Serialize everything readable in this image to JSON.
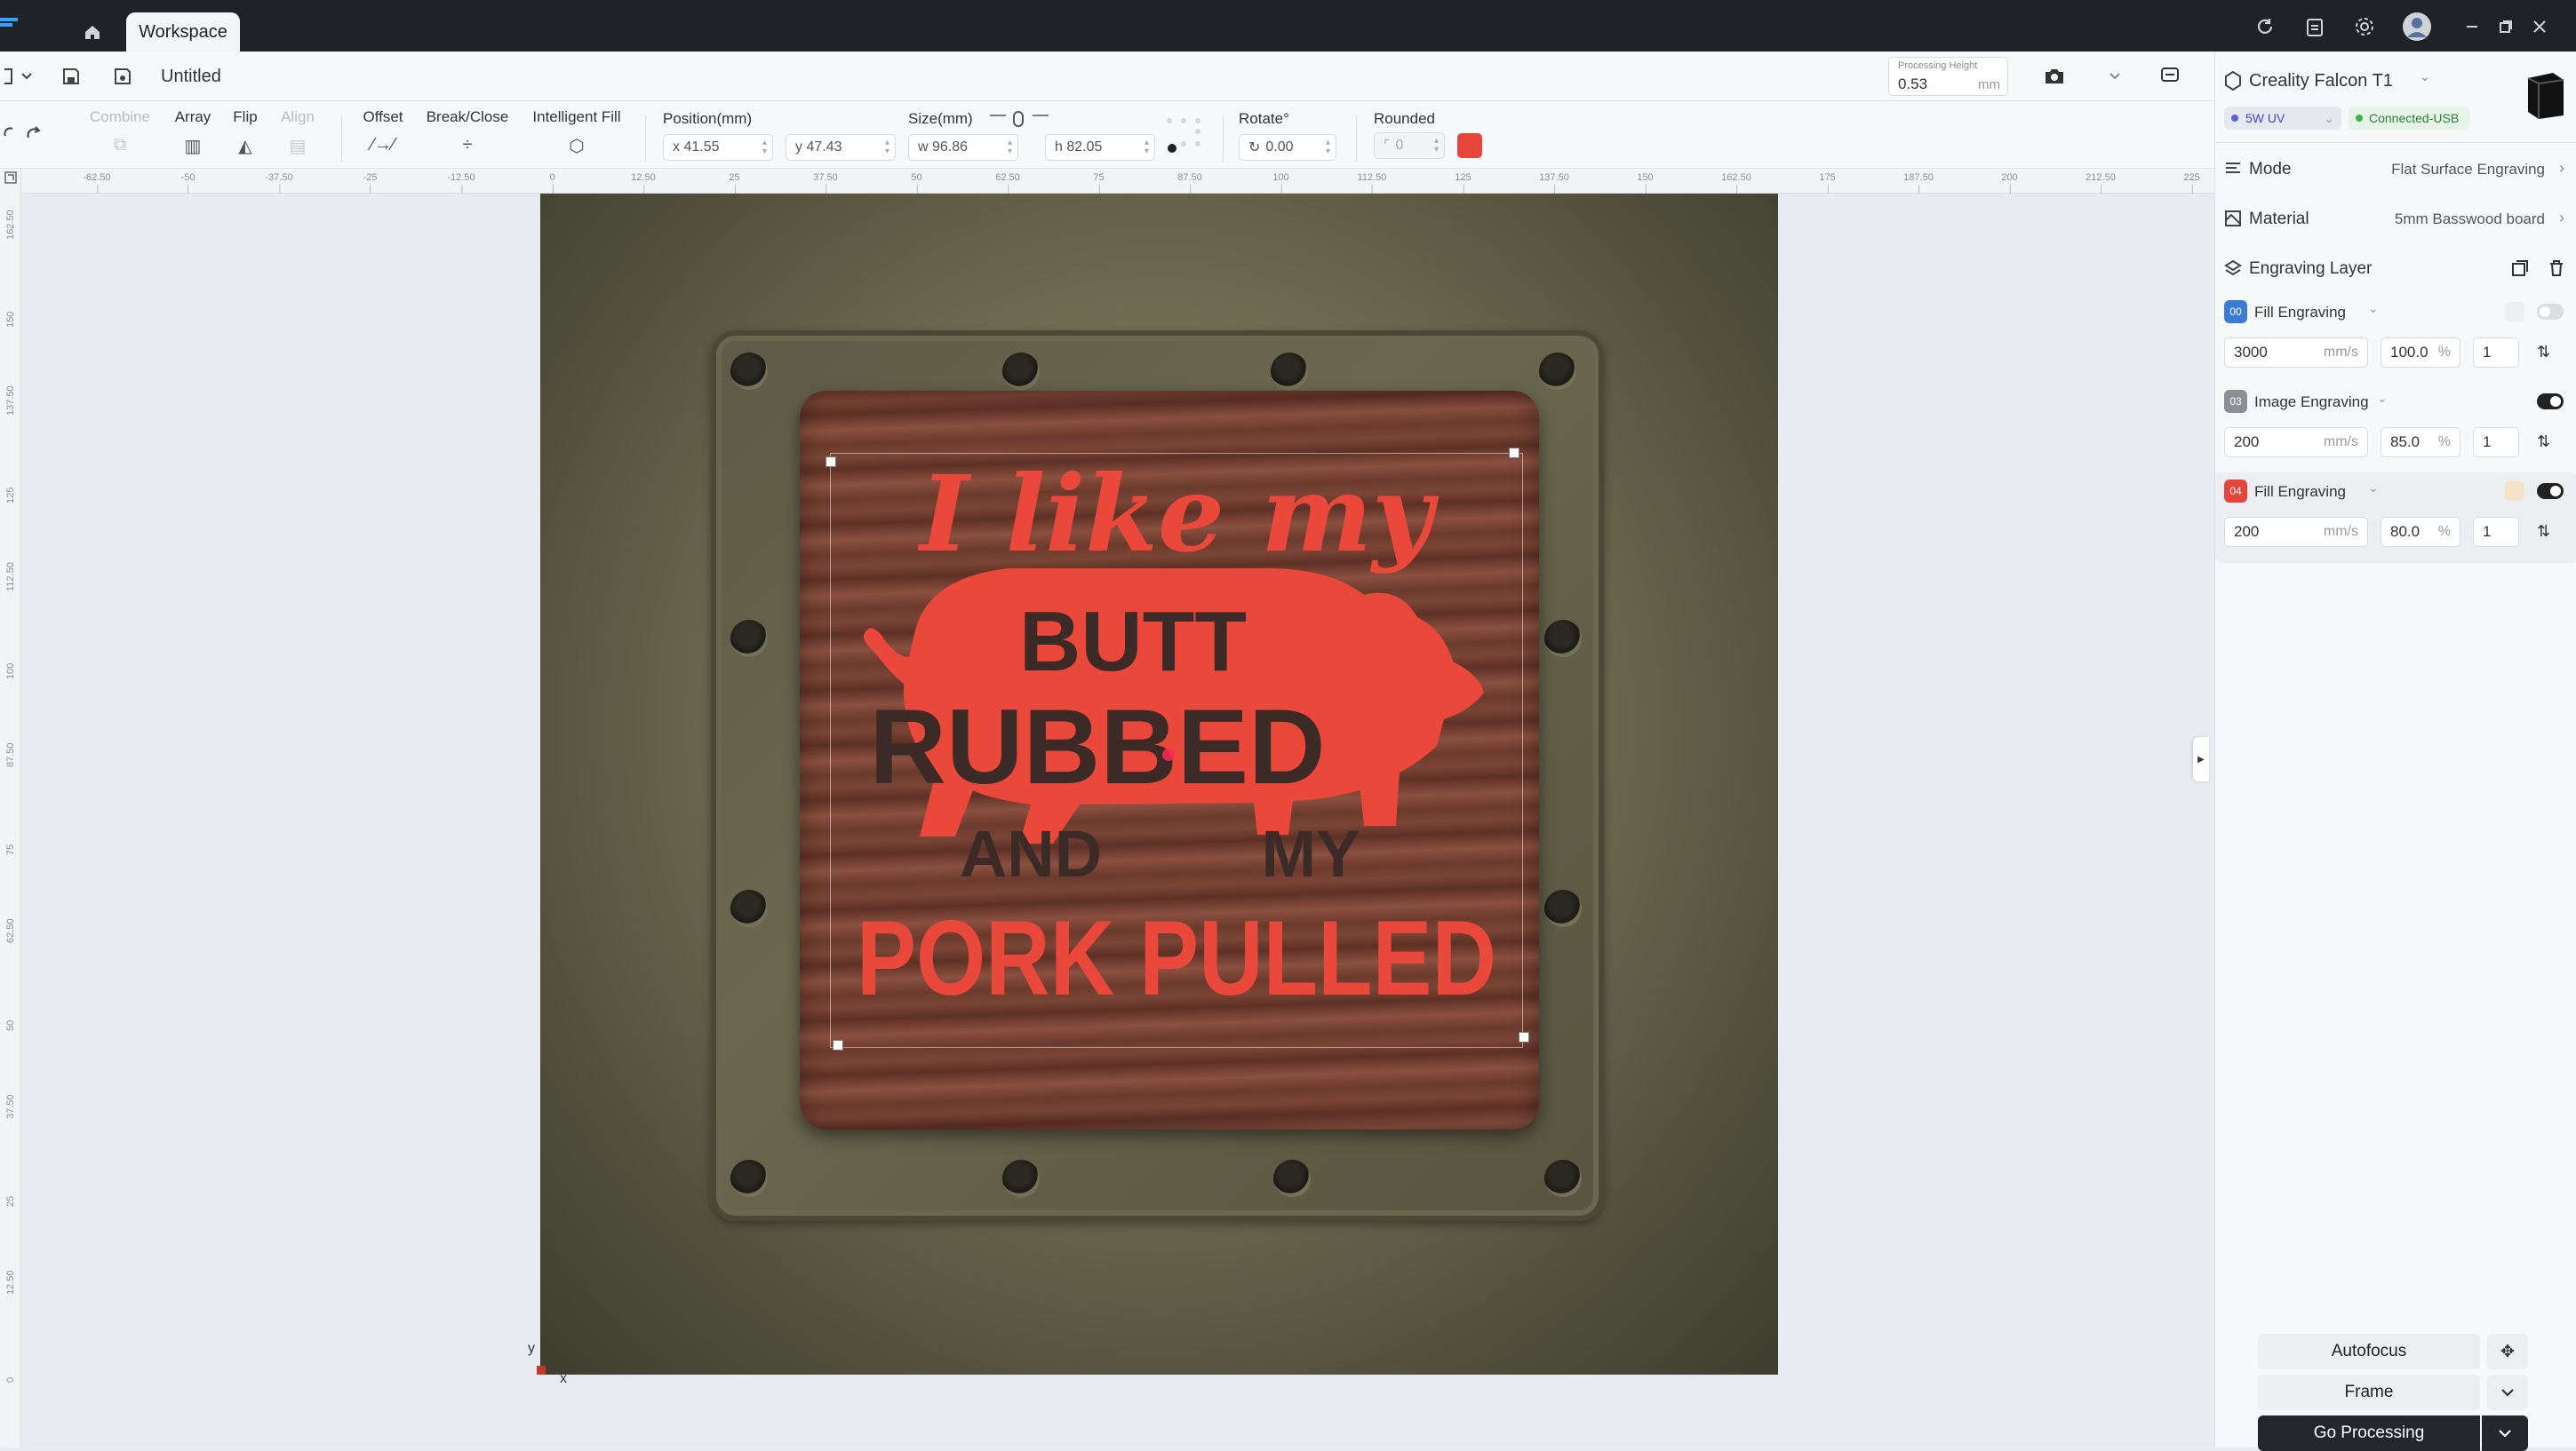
{
  "titlebar": {
    "tab_label": "Workspace",
    "icons": [
      "refresh-icon",
      "clipboard-icon",
      "gear-icon",
      "avatar-icon",
      "minimize-icon",
      "restore-icon",
      "close-icon"
    ]
  },
  "filebar": {
    "doc_title": "Untitled",
    "processing_height_label": "Processing Height",
    "processing_height_value": "0.53",
    "processing_height_unit": "mm"
  },
  "toolbar": {
    "combine": "Combine",
    "array": "Array",
    "flip": "Flip",
    "align": "Align",
    "offset": "Offset",
    "break_close": "Break/Close",
    "intelligent_fill": "Intelligent Fill",
    "position_label": "Position(mm)",
    "x_value": "x 41.55",
    "y_value": "y 47.43",
    "size_label": "Size(mm)",
    "w_value": "w 96.86",
    "h_value": "h 82.05",
    "rotate_label": "Rotate°",
    "rotate_value": "0.00",
    "rounded_label": "Rounded",
    "rounded_value": "0",
    "accent_color": "#e6453a"
  },
  "ruler": {
    "h_ticks": [
      "-62.50",
      "-50",
      "-37.50",
      "-25",
      "-12.50",
      "0",
      "12.50",
      "25",
      "37.50",
      "50",
      "62.50",
      "75",
      "87.50",
      "100",
      "112.50",
      "125",
      "137.50",
      "150",
      "162.50",
      "175",
      "187.50",
      "200",
      "212.50",
      "225"
    ],
    "v_ticks": [
      "162.50",
      "150",
      "137.50",
      "125",
      "112.50",
      "100",
      "87.50",
      "75",
      "62.50",
      "50",
      "37.50",
      "25",
      "12.50",
      "0"
    ]
  },
  "canvas": {
    "design_lines": [
      "I like my",
      "BUTT",
      "RUBBED",
      "AND",
      "MY",
      "PORK PULLED"
    ],
    "design_color": "#e9483a",
    "axis_y": "y",
    "axis_x": "x"
  },
  "panel": {
    "device_name": "Creality Falcon T1",
    "laser": "5W UV",
    "connection": "Connected-USB",
    "mode_label": "Mode",
    "mode_value": "Flat Surface Engraving",
    "material_label": "Material",
    "material_value": "5mm Basswood board",
    "layer_header": "Engraving Layer",
    "layers": [
      {
        "badge": "00",
        "badge_color": "#3a7bd5",
        "name": "Fill Engraving",
        "speed": "3000",
        "unit": "mm/s",
        "power": "100.0",
        "pct": "%",
        "passes": "1",
        "enabled": false
      },
      {
        "badge": "03",
        "badge_color": "#8b8f96",
        "name": "Image Engraving",
        "speed": "200",
        "unit": "mm/s",
        "power": "85.0",
        "pct": "%",
        "passes": "1",
        "enabled": true
      },
      {
        "badge": "04",
        "badge_color": "#e6453a",
        "name": "Fill Engraving",
        "speed": "200",
        "unit": "mm/s",
        "power": "80.0",
        "pct": "%",
        "passes": "1",
        "enabled": true
      }
    ],
    "autofocus": "Autofocus",
    "frame": "Frame",
    "go_processing": "Go Processing"
  }
}
